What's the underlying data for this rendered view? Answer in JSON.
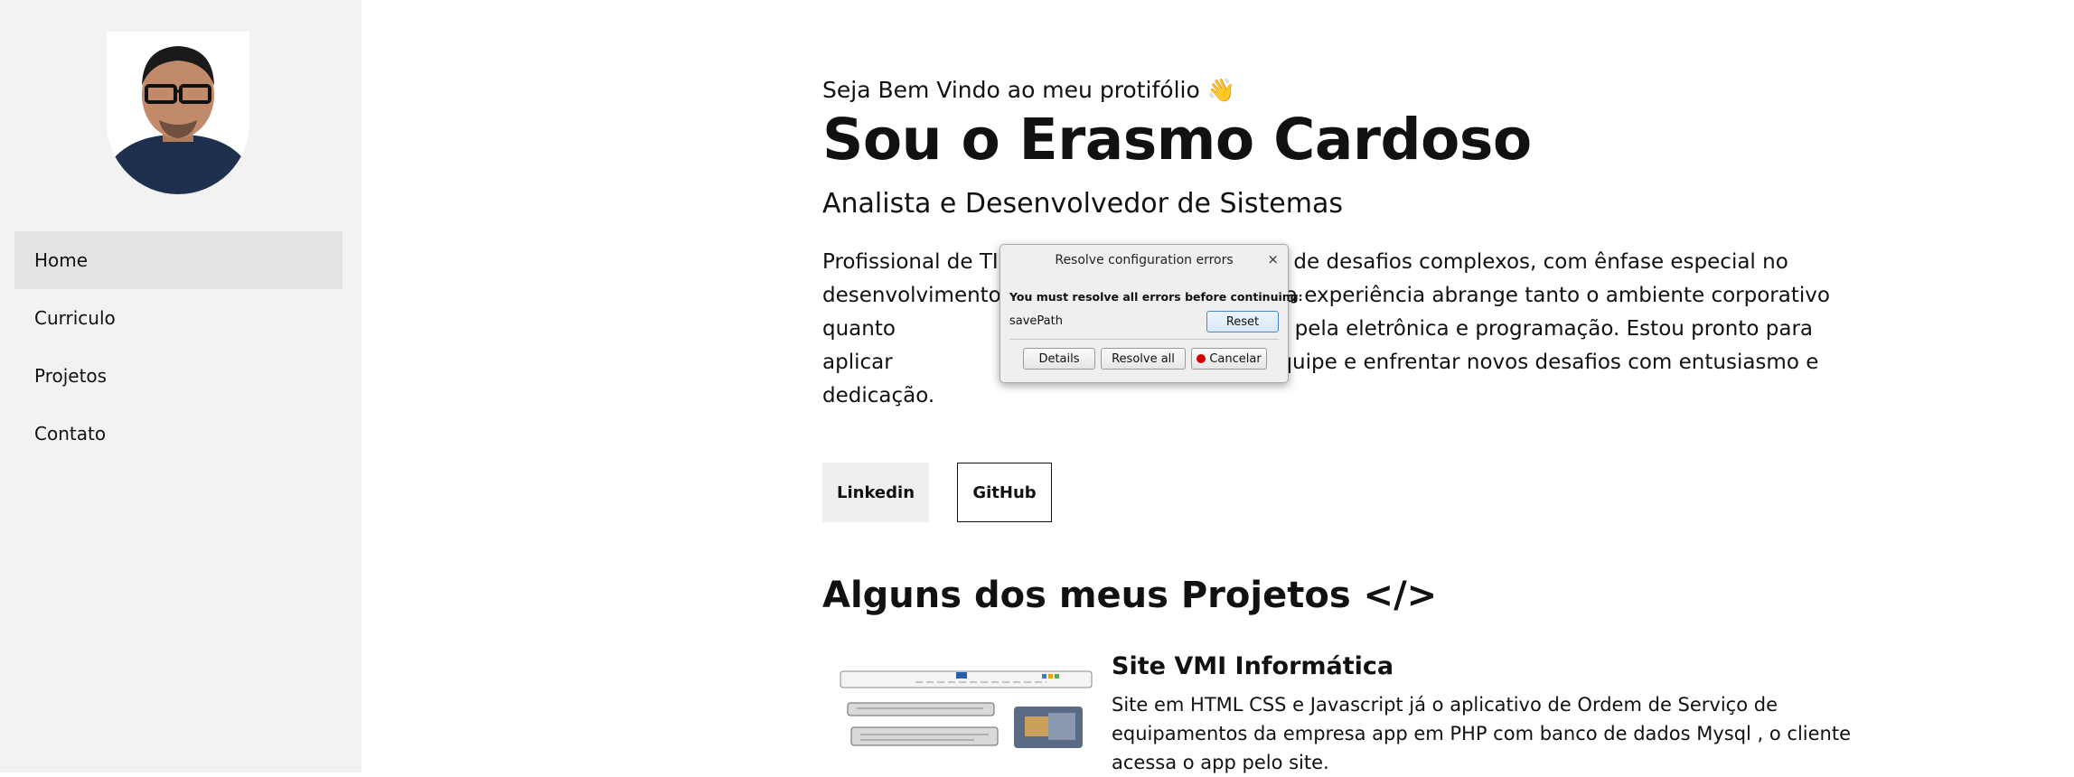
{
  "sidebar": {
    "nav": [
      {
        "label": "Home",
        "active": true
      },
      {
        "label": "Curriculo",
        "active": false
      },
      {
        "label": "Projetos",
        "active": false
      },
      {
        "label": "Contato",
        "active": false
      }
    ],
    "background": "#f2f2f2"
  },
  "main": {
    "welcome": "Seja Bem Vindo ao meu protifólio 👋",
    "name": "Sou o Erasmo Cardoso",
    "role": "Analista e Desenvolvedor de Sistemas",
    "intro_parts": [
      "Profissional de TI e",
      "esolução de desafios complexos, com ênfase especial no desenvolvimento c",
      "es. Minha experiência abrange tanto o ambiente corporativo quanto",
      "etindo minha paixão pela eletrônica e programação. Estou pronto para aplicar",
      "onar o sucesso da equipe e enfrentar novos desafios com entusiasmo e dedicação."
    ],
    "buttons": {
      "linkedin": "Linkedin",
      "github": "GitHub"
    },
    "projects_title": "Alguns dos meus Projetos </>",
    "projects": [
      {
        "title": "Site VMI Informática",
        "description": "Site em HTML CSS e Javascript já o aplicativo de Ordem de Serviço de equipamentos da empresa app em PHP com banco de dados Mysql , o cliente acessa o app pelo site."
      }
    ]
  },
  "dialog": {
    "title": "Resolve configuration errors",
    "message": "You must resolve all errors before continuing:",
    "field": "savePath",
    "reset": "Reset",
    "details": "Details",
    "resolve_all": "Resolve all",
    "cancel": "Cancelar",
    "close_icon": "×"
  }
}
